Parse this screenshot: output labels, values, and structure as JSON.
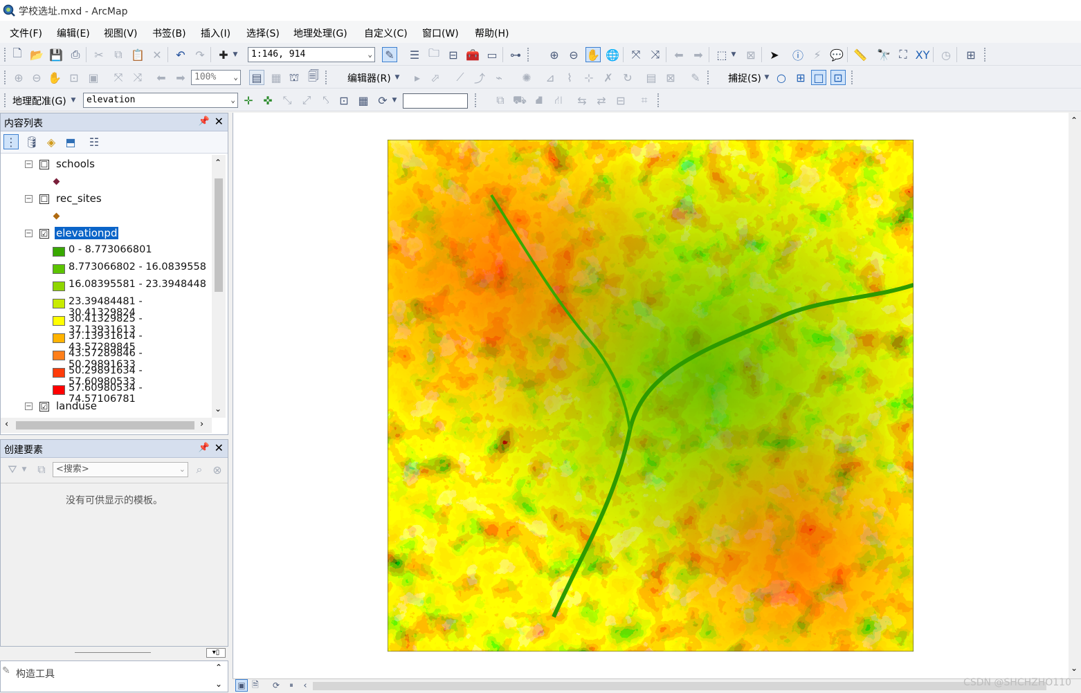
{
  "window": {
    "title": "学校选址.mxd - ArcMap"
  },
  "menubar": {
    "items": [
      "文件(F)",
      "编辑(E)",
      "视图(V)",
      "书签(B)",
      "插入(I)",
      "选择(S)",
      "地理处理(G)",
      "自定义(C)",
      "窗口(W)",
      "帮助(H)"
    ]
  },
  "toolbar1": {
    "scale_value": "1:146, 914"
  },
  "toolbar2": {
    "zoom_value": "100%",
    "editor_label": "编辑器(R)",
    "snapping_label": "捕捉(S)"
  },
  "toolbar3": {
    "georef_label": "地理配准(G)",
    "georef_layer": "elevation",
    "empty_input": ""
  },
  "toc": {
    "title": "内容列表",
    "layers": [
      {
        "name": "schools",
        "checked": "☐"
      },
      {
        "name": "rec_sites",
        "checked": "☐"
      },
      {
        "name": "elevationpd",
        "checked": "☑"
      },
      {
        "name": "landuse",
        "checked": "☑"
      }
    ],
    "classes": [
      {
        "label": "0 - 8.773066801",
        "color": "#38a800"
      },
      {
        "label": "8.773066802 - 16.0839558",
        "color": "#5cc400"
      },
      {
        "label": "16.08395581 - 23.3948448",
        "color": "#8fd600"
      },
      {
        "label": "23.39484481 - 30.41329824",
        "color": "#c8eb00"
      },
      {
        "label": "30.41329825 - 37.13931613",
        "color": "#ffff00"
      },
      {
        "label": "37.13931614 - 43.57289845",
        "color": "#ffb300"
      },
      {
        "label": "43.57289846 - 50.29891633",
        "color": "#ff7f1a"
      },
      {
        "label": "50.29891634 - 57.60980533",
        "color": "#ff3c0a"
      },
      {
        "label": "57.60980534 - 74.57106781",
        "color": "#ff0000"
      }
    ]
  },
  "create_features": {
    "title": "创建要素",
    "search_placeholder": "<搜索>",
    "empty_message": "没有可供显示的模板。"
  },
  "construct_tools": {
    "title": "构造工具"
  },
  "watermark": "CSDN @SHCHZHO110"
}
